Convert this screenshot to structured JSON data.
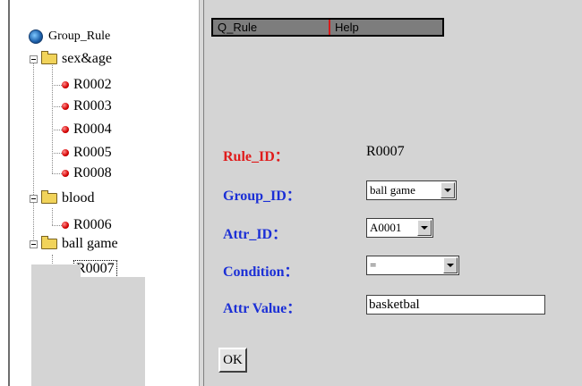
{
  "tree": {
    "root": "Group_Rule",
    "groups": [
      {
        "label": "sex&age",
        "rules": [
          "R0002",
          "R0003",
          "R0004",
          "R0005",
          "R0008"
        ]
      },
      {
        "label": "blood",
        "rules": [
          "R0006"
        ]
      },
      {
        "label": "ball game",
        "rules": [
          "R0007"
        ]
      }
    ]
  },
  "menu": {
    "item1": "Q_Rule",
    "item2": "Help"
  },
  "form": {
    "rule_id_label": "Rule_ID：",
    "rule_id_value": "R0007",
    "group_id_label": "Group_ID：",
    "group_id_value": "ball game",
    "attr_id_label": "Attr_ID：",
    "attr_id_value": "A0001",
    "condition_label": "Condition：",
    "condition_value": "=",
    "attr_value_label": "Attr Value：",
    "attr_value_value": "basketbal",
    "ok_label": "OK"
  },
  "colors": {
    "rule_label": "#e01b1b",
    "field_label": "#1b2fd6",
    "menubar": "#7d7d7d",
    "background": "#d4d4d4"
  }
}
